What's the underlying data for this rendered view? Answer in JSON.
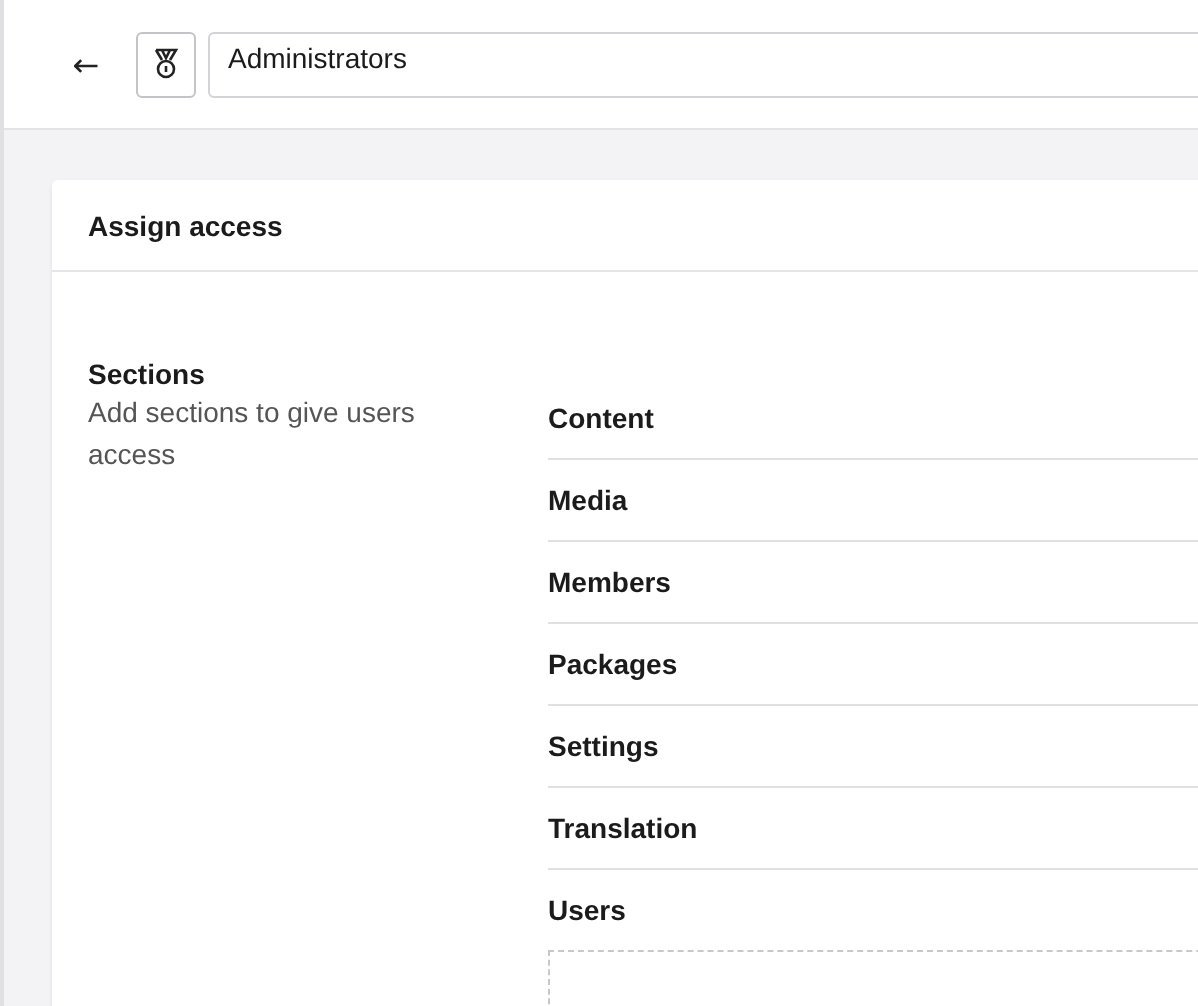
{
  "header": {
    "back": "←",
    "name": "Administrators"
  },
  "card": {
    "title": "Assign access",
    "sections": {
      "label": "Sections",
      "description": "Add sections to give users access",
      "items": [
        {
          "name": "Content"
        },
        {
          "name": "Media"
        },
        {
          "name": "Members"
        },
        {
          "name": "Packages"
        },
        {
          "name": "Settings"
        },
        {
          "name": "Translation"
        },
        {
          "name": "Users"
        }
      ]
    }
  }
}
